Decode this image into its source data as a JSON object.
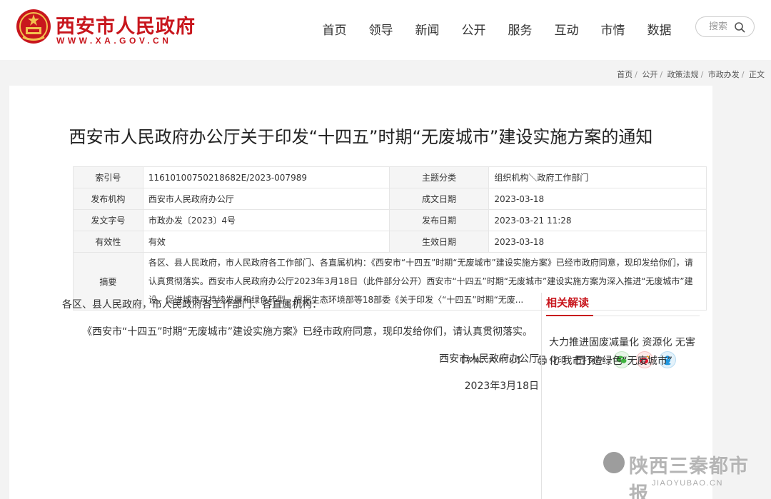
{
  "header": {
    "site_name": "西安市人民政府",
    "site_url": "WWW.XA.GOV.CN",
    "nav": [
      "首页",
      "领导",
      "新闻",
      "公开",
      "服务",
      "互动",
      "市情",
      "数据"
    ],
    "search_placeholder": "搜索"
  },
  "breadcrumb": [
    "首页",
    "公开",
    "政策法规",
    "市政办发",
    "正文"
  ],
  "article": {
    "title": "西安市人民政府办公厅关于印发“十四五”时期“无废城市”建设实施方案的通知",
    "info": {
      "index_label": "索引号",
      "index_value": "11610100750218682E/2023-007989",
      "topic_label": "主题分类",
      "topic_value": "组织机构＼政府工作部门",
      "publisher_label": "发布机构",
      "publisher_value": "西安市人民政府办公厅",
      "created_label": "成文日期",
      "created_value": "2023-03-18",
      "docno_label": "发文字号",
      "docno_value": "市政办发〔2023〕4号",
      "pubdate_label": "发布日期",
      "pubdate_value": "2023-03-21 11:28",
      "validity_label": "有效性",
      "validity_value": "有效",
      "effective_label": "生效日期",
      "effective_value": "2023-03-18",
      "abstract_label": "摘要",
      "abstract_value": "各区、县人民政府，市人民政府各工作部门、各直属机构：《西安市“十四五”时期“无废城市”建设实施方案》已经市政府同意，现印发给你们，请认真贯彻落实。西安市人民政府办公厅2023年3月18日（此件部分公开）西安市“十四五”时期“无废城市”建设实施方案为深入推进“无废城市”建设，促进城市可持续发展和绿色转型，根据生态环境部等18部委《关于印发〈“十四五”时期“无废..."
    },
    "tools": {
      "font_size": "【字体：大 中 小】",
      "print": "打印",
      "save": "保存"
    },
    "body": {
      "salutation": "各区、县人民政府，市人民政府各工作部门、各直属机构：",
      "paragraph": "《西安市“十四五”时期“无废城市”建设实施方案》已经市政府同意，现印发给你们，请认真贯彻落实。",
      "signature": "西安市人民政府办公厅",
      "date": "2023年3月18日"
    }
  },
  "related": {
    "heading": "相关解读",
    "items": [
      "大力推进固废减量化 资源化 无害化 我市打造绿色“无废城市”"
    ]
  },
  "watermark": {
    "text": "陕西三秦都市报",
    "sub": "JIAOYUBAO.CN"
  },
  "colors": {
    "brand_red": "#c8161d"
  }
}
